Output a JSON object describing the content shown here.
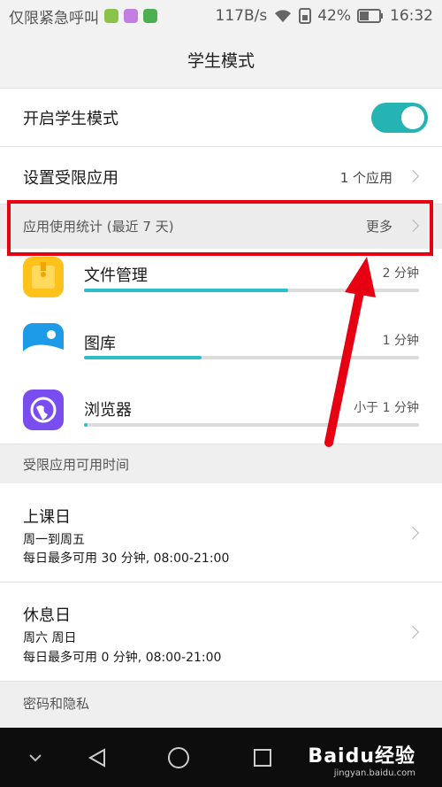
{
  "statusbar": {
    "carrier": "仅限紧急呼叫",
    "speed": "117B/s",
    "battery": "42%",
    "time": "16:32"
  },
  "header": {
    "title": "学生模式"
  },
  "student_mode_toggle": {
    "label": "开启学生模式",
    "on": true
  },
  "restricted_apps": {
    "label": "设置受限应用",
    "value": "1 个应用"
  },
  "usage_header": {
    "label": "应用使用统计 (最近 7 天)",
    "more": "更多"
  },
  "apps": [
    {
      "name": "文件管理",
      "time": "2 分钟",
      "progress": 0.61,
      "icon": "file-manager-icon",
      "color": "#ffc21a"
    },
    {
      "name": "图库",
      "time": "1 分钟",
      "progress": 0.35,
      "icon": "gallery-icon",
      "color": "#1e9be8"
    },
    {
      "name": "浏览器",
      "time": "小于 1 分钟",
      "progress": 0.01,
      "icon": "browser-icon",
      "color": "#7a4df0"
    }
  ],
  "available_time_header": "受限应用可用时间",
  "schedules": [
    {
      "title": "上课日",
      "days": "周一到周五",
      "detail": "每日最多可用 30 分钟, 08:00-21:00"
    },
    {
      "title": "休息日",
      "days": "周六 周日",
      "detail": "每日最多可用 0 分钟, 08:00-21:00"
    }
  ],
  "password_privacy_header": "密码和隐私",
  "watermark": {
    "logo": "Baidu经验",
    "url": "jingyan.baidu.com"
  },
  "colors": {
    "accent": "#26b3b3",
    "progress": "#2dbfc8",
    "annotation": "#e60012"
  }
}
